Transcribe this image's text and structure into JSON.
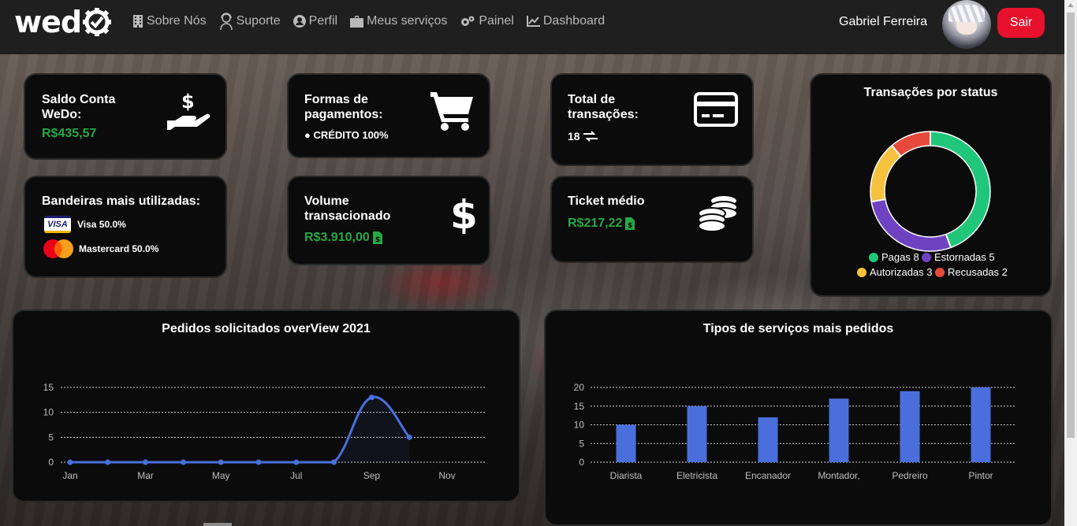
{
  "navbar": {
    "brand": "wed",
    "items": [
      {
        "label": "Sobre Nós",
        "icon": "building-icon"
      },
      {
        "label": "Suporte",
        "icon": "support-agent-icon"
      },
      {
        "label": "Perfil",
        "icon": "user-circle-icon"
      },
      {
        "label": "Meus serviços",
        "icon": "briefcase-icon"
      },
      {
        "label": "Painel",
        "icon": "cogs-icon"
      },
      {
        "label": "Dashboard",
        "icon": "chart-line-icon"
      }
    ],
    "user_name": "Gabriel Ferreira",
    "logout_label": "Sair"
  },
  "cards": {
    "saldo": {
      "title": "Saldo Conta WeDo:",
      "value": "R$435,57",
      "icon": "hand-dollar-icon"
    },
    "formas": {
      "title": "Formas de pagamentos:",
      "detail": "● CRÉDITO 100%",
      "icon": "cart-icon"
    },
    "total": {
      "title": "Total de transações:",
      "value": "18",
      "icon": "credit-card-icon"
    },
    "bandeiras": {
      "title": "Bandeiras mais utilizadas:",
      "items": [
        {
          "label": "Visa 50.0%",
          "logo_text": "VISA",
          "icon": "visa-logo-icon"
        },
        {
          "label": "Mastercard 50.0%",
          "icon": "mastercard-logo-icon"
        }
      ]
    },
    "volume": {
      "title": "Volume transacionado",
      "value": "R$3.910,00",
      "icon": "dollar-icon"
    },
    "ticket": {
      "title": "Ticket médio",
      "value": "R$217,22",
      "icon": "coins-icon"
    }
  },
  "status_panel": {
    "title": "Transações por status"
  },
  "line_panel": {
    "title": "Pedidos solicitados overView 2021"
  },
  "bar_panel": {
    "title": "Tipos de serviços mais pedidos"
  },
  "colors": {
    "accent_red": "#e8112d",
    "green": "#28a745",
    "paid": "#20c77a",
    "reversed": "#6f42c1",
    "authorized": "#f6c23e",
    "refused": "#e74a3b",
    "line": "#4a6fdc",
    "bar": "#4a6fdc"
  },
  "chart_data": [
    {
      "type": "pie",
      "title": "Transações por status",
      "categories": [
        "Pagas",
        "Estornadas",
        "Autorizadas",
        "Recusadas"
      ],
      "values": [
        8,
        5,
        3,
        2
      ],
      "legend_labels": [
        "Pagas 8",
        "Estornadas 5",
        "Autorizadas 3",
        "Recusadas 2"
      ],
      "legend_position": "bottom"
    },
    {
      "type": "line",
      "title": "Pedidos solicitados overView 2021",
      "x": [
        "Jan",
        "Feb",
        "Mar",
        "Apr",
        "May",
        "Jun",
        "Jul",
        "Aug",
        "Sep",
        "Oct"
      ],
      "values": [
        0,
        0,
        0,
        0,
        0,
        0,
        0,
        0,
        13,
        5
      ],
      "xticks": [
        "Jan",
        "Mar",
        "May",
        "Jul",
        "Sep",
        "Nov"
      ],
      "yticks": [
        0,
        5,
        10,
        15
      ],
      "ylim": [
        0,
        15
      ],
      "grid": true
    },
    {
      "type": "bar",
      "title": "Tipos de serviços mais pedidos",
      "categories": [
        "Diarista",
        "Eletricista",
        "Encanador",
        "Montador,",
        "Pedreiro",
        "Pintor"
      ],
      "values": [
        10,
        15,
        12,
        17,
        19,
        20
      ],
      "yticks": [
        0,
        5,
        10,
        15,
        20
      ],
      "ylim": [
        0,
        20
      ],
      "grid": true
    }
  ]
}
